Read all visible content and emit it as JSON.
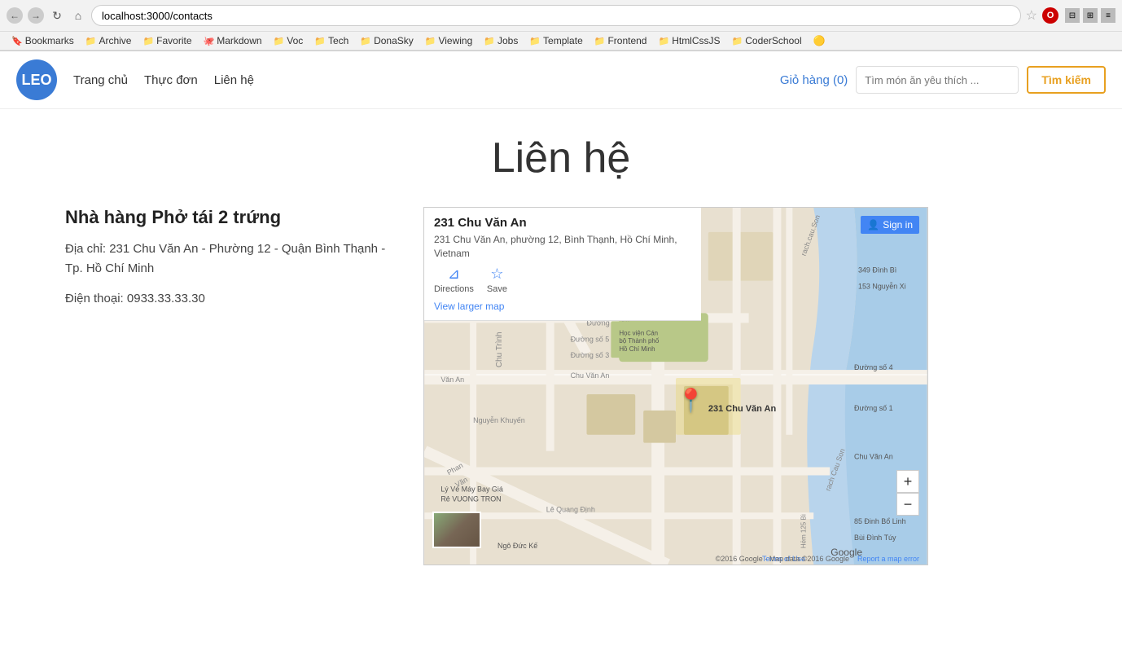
{
  "browser": {
    "url": "localhost:3000/contacts",
    "back_label": "←",
    "forward_label": "→",
    "reload_label": "↻",
    "home_label": "⌂",
    "star_label": "☆",
    "opera_label": "O"
  },
  "bookmarks": [
    {
      "label": "Bookmarks",
      "icon": "🔖"
    },
    {
      "label": "Archive",
      "icon": "📁"
    },
    {
      "label": "Favorite",
      "icon": "📁"
    },
    {
      "label": "Markdown",
      "icon": "🐙"
    },
    {
      "label": "Voc",
      "icon": "📁"
    },
    {
      "label": "Tech",
      "icon": "📁"
    },
    {
      "label": "DonaSky",
      "icon": "📁"
    },
    {
      "label": "Viewing",
      "icon": "📁"
    },
    {
      "label": "Jobs",
      "icon": "📁"
    },
    {
      "label": "Template",
      "icon": "📁"
    },
    {
      "label": "Frontend",
      "icon": "📁"
    },
    {
      "label": "HtmlCssJS",
      "icon": "📁"
    },
    {
      "label": "CoderSchool",
      "icon": "📁"
    },
    {
      "label": "🟡",
      "icon": ""
    }
  ],
  "site": {
    "logo_text": "LEO",
    "nav_items": [
      "Trang chủ",
      "Thực đơn",
      "Liên hệ"
    ],
    "cart_label": "Giỏ hàng (0)",
    "search_placeholder": "Tìm món ăn yêu thích ...",
    "search_btn_label": "Tìm kiếm"
  },
  "page": {
    "title": "Liên hệ",
    "restaurant_name": "Nhà hàng Phở tái 2 trứng",
    "address_label": "Địa chỉ:",
    "address_value": "231 Chu Văn An - Phường 12 - Quận Bình Thạnh - Tp. Hồ Chí Minh",
    "phone_label": "Điện thoại:",
    "phone_value": "0933.33.33.30"
  },
  "map": {
    "place_name": "231 Chu Văn An",
    "place_address": "231 Chu Văn An, phường 12, Bình Thạnh, Hồ Chí Minh, Vietnam",
    "directions_label": "Directions",
    "save_label": "Save",
    "view_larger_label": "View larger map",
    "sign_in_label": "Sign in",
    "pin_label": "231 Chu Văn An",
    "google_label": "Google",
    "copyright": "©2016 Google · Map data ©2016 Google",
    "terms_label": "Terms of Use",
    "report_label": "Report a map error",
    "zoom_in": "+",
    "zoom_out": "−"
  }
}
